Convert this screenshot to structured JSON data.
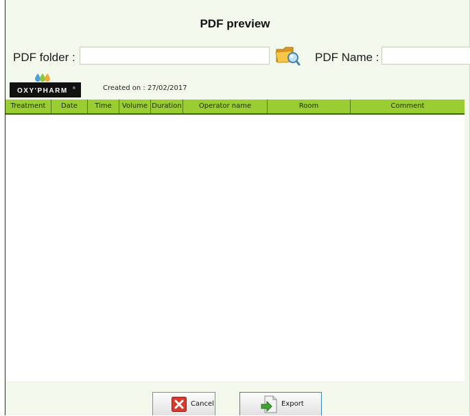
{
  "window": {
    "title": "PDF preview"
  },
  "folder": {
    "label": "PDF folder :",
    "value": "",
    "browse_icon": "folder-search-icon"
  },
  "name": {
    "label": "PDF Name :",
    "value": ""
  },
  "logo": {
    "text": "OXY'PHARM",
    "trademark": "®",
    "drop_colors": [
      "#4aa3df",
      "#8cc63f",
      "#f2a93b"
    ]
  },
  "created": {
    "label": "Created on :",
    "date": "27/02/2017"
  },
  "table": {
    "header_color": "#9acd32",
    "columns": [
      "Treatment",
      "Date",
      "Time",
      "Volume",
      "Duration",
      "Operator name",
      "Room",
      "Comment"
    ],
    "rows": []
  },
  "buttons": {
    "cancel": {
      "label": "Cancel",
      "icon": "red-x-icon"
    },
    "export": {
      "label": "Export",
      "icon": "export-arrow-icon"
    }
  }
}
